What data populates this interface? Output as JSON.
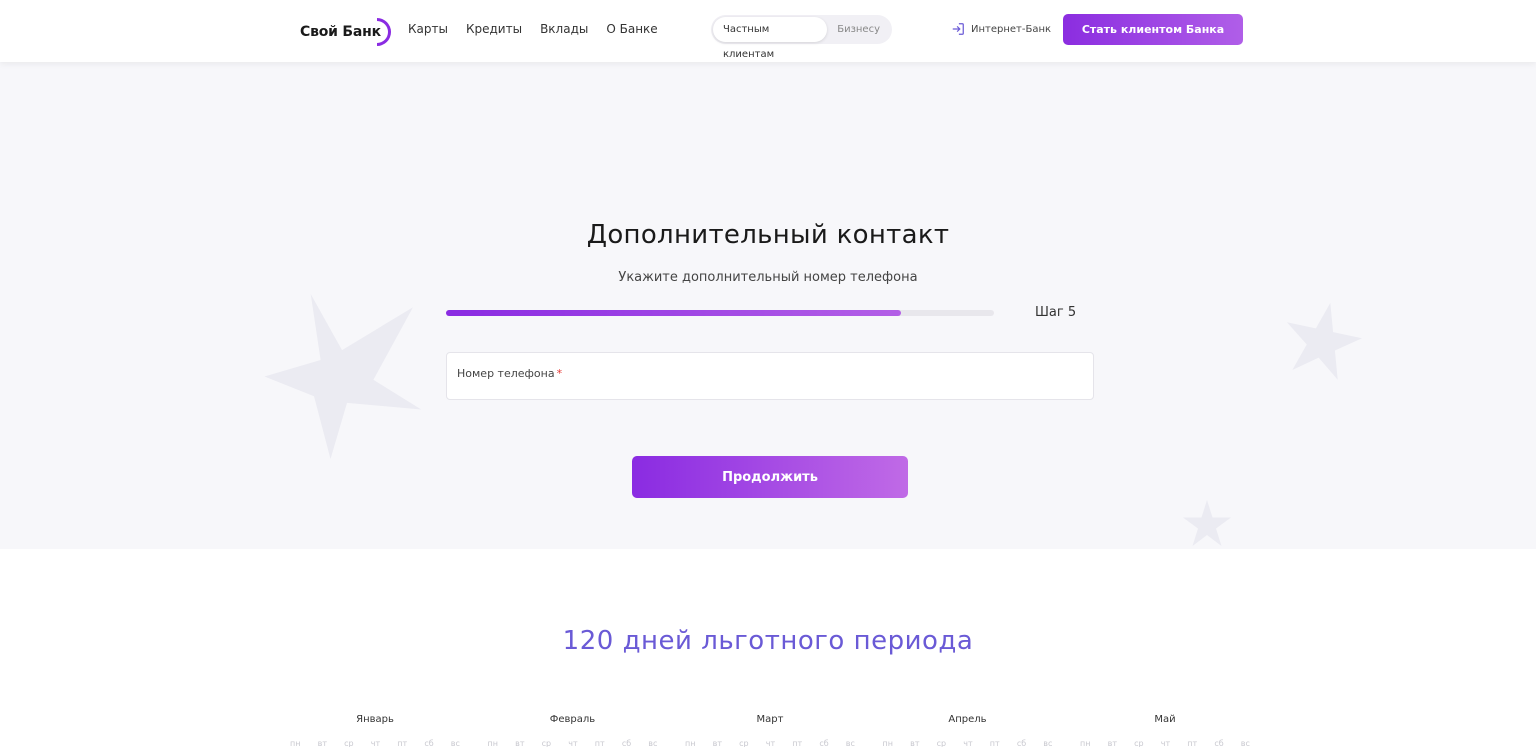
{
  "header": {
    "logo_text": "Свой Банк",
    "nav": [
      "Карты",
      "Кредиты",
      "Вклады",
      "О Банке"
    ],
    "segment": {
      "options": [
        "Частным клиентам",
        "Бизнесу"
      ],
      "active": "Частным клиентам"
    },
    "internet_bank": "Интернет-Банк",
    "become_client": "Стать клиентом Банка"
  },
  "form": {
    "title": "Дополнительный контакт",
    "subtitle": "Укажите дополнительный номер телефона",
    "progress_percent": 83,
    "step_label": "Шаг 5",
    "phone_label": "Номер телефона",
    "required_mark": "*",
    "continue_label": "Продолжить"
  },
  "promo": {
    "title": "120 дней льготного периода",
    "months": [
      "Январь",
      "Февраль",
      "Март",
      "Апрель",
      "Май"
    ],
    "weekdays": [
      "пн",
      "вт",
      "ср",
      "чт",
      "пт",
      "сб",
      "вс"
    ]
  },
  "colors": {
    "accent": "#8a2be2",
    "accent_light": "#b35fe6",
    "promo_title": "#6a5ad6",
    "hero_bg": "#f7f7fa"
  }
}
